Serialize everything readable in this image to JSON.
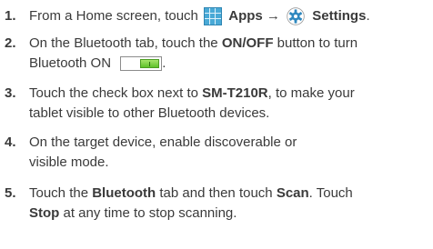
{
  "steps": [
    {
      "num": "1.",
      "t1": "From a Home screen, touch",
      "apps_label": "Apps",
      "arrow": "→",
      "settings_label": "Settings",
      "t2": "."
    },
    {
      "num": "2.",
      "t1": "On the Bluetooth tab, touch the ",
      "on_off": "ON/OFF",
      "t2": " button to turn",
      "t3": "Bluetooth ON",
      "t4": "."
    },
    {
      "num": "3.",
      "t1": "Touch the check box next to ",
      "device": "SM-T210R",
      "t2": ", to make your",
      "t3": "tablet visible to other Bluetooth devices."
    },
    {
      "num": "4.",
      "t1": "On the target device, enable discoverable or",
      "t2": "visible mode."
    },
    {
      "num": "5.",
      "t1": "Touch the ",
      "bluetooth": "Bluetooth",
      "t2": " tab and then touch ",
      "scan": "Scan",
      "t3": ". Touch",
      "stop": "Stop",
      "t4": " at any time to stop scanning."
    }
  ],
  "icons": {
    "apps": "apps-grid-icon",
    "settings": "gear-icon",
    "toggle": "on-off-toggle"
  },
  "colors": {
    "apps_icon": "#49a9d6",
    "gear_icon": "#2e88bf",
    "toggle_on": "#6ccf33",
    "text": "#3a3a3a"
  }
}
